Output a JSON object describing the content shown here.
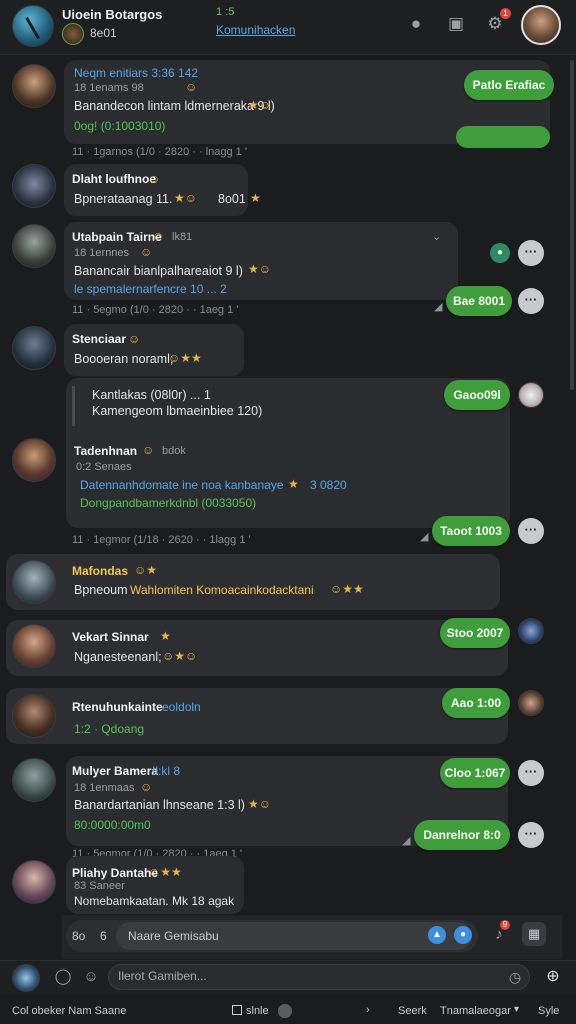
{
  "header": {
    "title": "Uioein Botargos",
    "subtitle": "8e01",
    "count": "1 :5",
    "link": "Komunihacken",
    "badge": "1"
  },
  "messages": [
    {
      "name": "Neqm enitiars 3:36 142",
      "line2": "18 1enams 98",
      "line3": "Banandecon lintam ldmerneraka 9 l)",
      "line4": "0og! (0:1003010)",
      "time": "11 · 1garnos (1/0 · 2820 · · lnagg 1 '",
      "pill": "Patlo Erafiac",
      "ticks": "",
      "names": {}
    },
    {
      "name": "Dlaht loufhnoe",
      "line2": "Bpnerataanag 11.",
      "emoji": "8o01"
    },
    {
      "name": "Utabpain Tairne",
      "name_tail": "lk81",
      "line2": "18 1ernnes",
      "line3": "Banancair bianlpalhareaiot 9 l)",
      "line4": "le spemalernarfencre  10 ...  2",
      "time": "11 · 5egmo (1/0 · 2820 · · 1aeg 1 '",
      "pill": "Bae 8001"
    },
    {
      "name": "Stenciaar",
      "line2": "Boooeran noraml;"
    },
    {
      "name": "Tadenhnan",
      "name_tail": "bdok",
      "q1": "Kantlakas  (08l0r) ...  1",
      "q2": "Kamengeom lbmaeinbiee 120)",
      "line2": "0:2 Senaes",
      "line3": "Datennanhdomate ine noa kanbanaye",
      "line3_tail": "3  0820",
      "line4": "Dongpandbamerkdnbl (0033050)",
      "pill1": "Gaoo09l",
      "pill2": "Taoot 1003",
      "time": "11 · 1egmor (1/18 · 2620 · · 1lagg 1 '"
    },
    {
      "name": "Mafondas",
      "line2": "Bpneoum",
      "line2_yellow": "Wahlomiten Komoacainkodacktani"
    },
    {
      "name": "Vekart Sinnar",
      "line2": "Nganesteenanl;",
      "pill": "Stoo 2007"
    },
    {
      "name": "Rtenuhunkainte",
      "name_tail": "eoldoln",
      "line2": "1:2 ·  Qdoang",
      "pill": "Aao 1:00"
    },
    {
      "name": "Mulyer Bamera",
      "name_tail": "Il:kl 8",
      "line2": "18 1enmaas",
      "line3": "Banardartanian lhnseane 1:3 l)",
      "line4": "80:0000:00m0",
      "time": "11 · 5egmor (1/0 · 2820 · · 1aeg 1 '",
      "pill1": "Cloo 1:067",
      "pill2": "Danrelnor 8:0"
    },
    {
      "name": "Pliahy Dantahe",
      "line2": "83 Saneer",
      "line3": "Nomebamkaatan. Mk 18 agak"
    }
  ],
  "composer": {
    "left_text": "8o",
    "left_text2": "6",
    "placeholder": "Naare Gemisabu",
    "badge": "9"
  },
  "bottom": {
    "search_placeholder": "Ilerot Gamiben..."
  },
  "status": {
    "left": "Col obeker Nam Saane",
    "mid1": "slnle",
    "mid2": "Seerk",
    "right1": "Tnamalaeogar",
    "right2": "Syle"
  }
}
